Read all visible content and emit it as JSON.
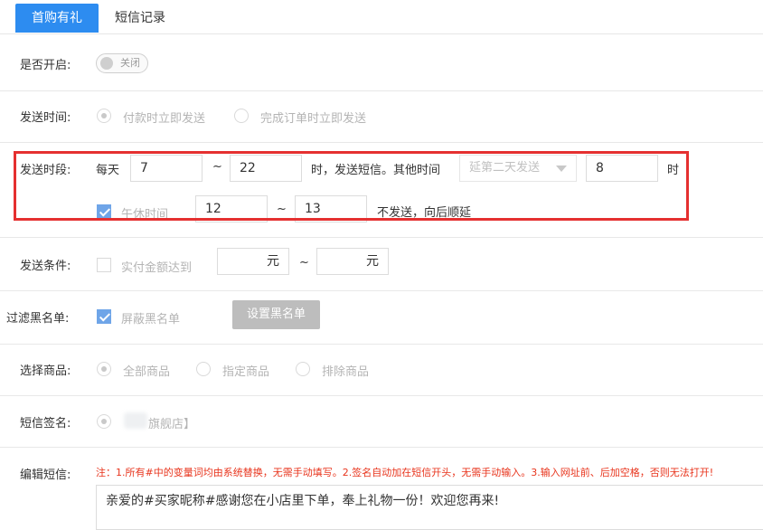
{
  "tabs": {
    "first_purchase": "首购有礼",
    "sms_records": "短信记录"
  },
  "enable": {
    "label": "是否开启:",
    "toggle_text": "关闭"
  },
  "send_time": {
    "label": "发送时间:",
    "options": [
      "付款时立即发送",
      "完成订单时立即发送"
    ]
  },
  "send_period": {
    "label": "发送时段:",
    "daily": "每天",
    "start": "7",
    "tilde": "~",
    "end": "22",
    "text_after": "时，发送短信。其他时间",
    "other_select": "延第二天发送",
    "other_hour": "8",
    "hour_unit": "时",
    "lunch_label": "午休时间",
    "lunch_start": "12",
    "lunch_end": "13",
    "lunch_note": "不发送，向后顺延"
  },
  "condition": {
    "label": "发送条件:",
    "checkbox_label": "实付金额达到",
    "min_unit": "元",
    "tilde": "~",
    "max_unit": "元"
  },
  "blacklist": {
    "label": "过滤黑名单:",
    "checkbox_label": "屏蔽黑名单",
    "button": "设置黑名单"
  },
  "goods": {
    "label": "选择商品:",
    "options": [
      "全部商品",
      "指定商品",
      "排除商品"
    ]
  },
  "signature": {
    "label": "短信签名:",
    "value": "旗舰店】"
  },
  "edit_sms": {
    "label": "编辑短信:",
    "note": "注：1.所有#中的变量词均由系统替换，无需手动填写。2.签名自动加在短信开头，无需手动输入。3.输入网址前、后加空格，否则无法打开!",
    "content": "亲爱的#买家昵称#感谢您在小店里下单，奉上礼物一份！欢迎您再来!"
  },
  "colors": {
    "accent": "#2d8cf0",
    "highlight_box": "#e53030",
    "note": "#e8341c"
  }
}
